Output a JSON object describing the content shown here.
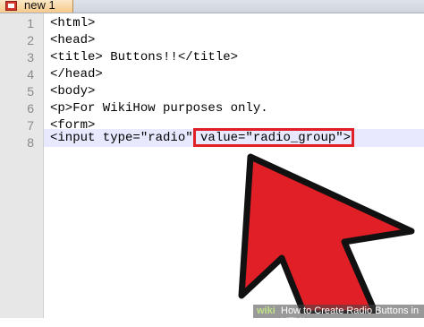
{
  "tab": {
    "label": "new 1",
    "icon": "file-icon"
  },
  "editor": {
    "lines": [
      {
        "number": "1",
        "text": "<html>"
      },
      {
        "number": "2",
        "text": "<head>"
      },
      {
        "number": "3",
        "text": "<title> Buttons!!</title>"
      },
      {
        "number": "4",
        "text": "</head>"
      },
      {
        "number": "5",
        "text": "<body>"
      },
      {
        "number": "6",
        "text": "<p>For WikiHow purposes only."
      },
      {
        "number": "7",
        "text": "<form>"
      },
      {
        "number": "8",
        "text": "<input type=\"radio\" value=\"radio_group\">"
      }
    ],
    "current_line": 8
  },
  "annotation": {
    "highlight_color": "#e01f26",
    "arrow_icon": "red-arrow-cursor-icon"
  },
  "watermark": {
    "brand": "wiki",
    "caption": "How to Create Radio Buttons in HTML"
  }
}
